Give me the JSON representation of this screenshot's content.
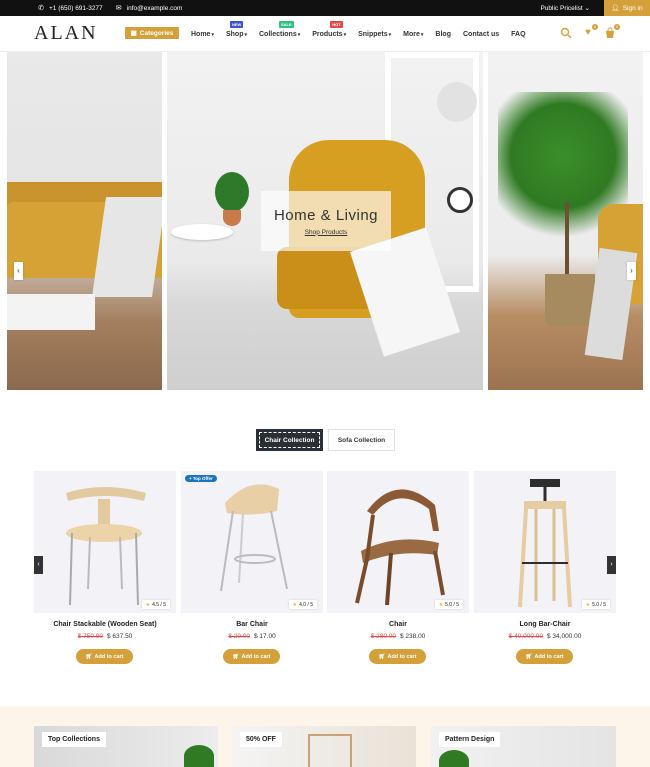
{
  "topbar": {
    "phone": "+1 (650) 691-3277",
    "email": "info@example.com",
    "pricelist": "Public Pricelist",
    "signin": "Sign in"
  },
  "header": {
    "logo": "ALAN",
    "categories": "Categories",
    "nav": [
      {
        "label": "Home",
        "chevron": true
      },
      {
        "label": "Shop",
        "chevron": true,
        "badge": "NEW",
        "badge_color": "#3f51d6"
      },
      {
        "label": "Collections",
        "chevron": true,
        "badge": "SALE",
        "badge_color": "#2ec27e"
      },
      {
        "label": "Products",
        "chevron": true,
        "badge": "HOT",
        "badge_color": "#e34b4b"
      },
      {
        "label": "Snippets",
        "chevron": true
      },
      {
        "label": "More",
        "chevron": true
      },
      {
        "label": "Blog",
        "chevron": false
      },
      {
        "label": "Contact us",
        "chevron": false
      },
      {
        "label": "FAQ",
        "chevron": false
      }
    ],
    "wishlist_count": "0",
    "cart_count": "0"
  },
  "hero": {
    "title": "Home & Living",
    "link": "Shop Products"
  },
  "tabs": {
    "active": "Chair Collection",
    "inactive": "Sofa Collection"
  },
  "products": [
    {
      "name": "Chair Stackable (Wooden Seat)",
      "old_price": "$ 750.00",
      "price": "$ 637.50",
      "rating": "4.5 / 5",
      "tag": "",
      "cart": "Add to cart"
    },
    {
      "name": "Bar Chair",
      "old_price": "$ 20.00",
      "price": "$ 17.00",
      "rating": "4.0 / 5",
      "tag": "Top Offer",
      "cart": "Add to cart"
    },
    {
      "name": "Chair",
      "old_price": "$ 280.00",
      "price": "$ 238.00",
      "rating": "5.0 / 5",
      "tag": "",
      "cart": "Add to cart"
    },
    {
      "name": "Long Bar-Chair",
      "old_price": "$ 40,000.00",
      "price": "$ 34,000.00",
      "rating": "5.0 / 5",
      "tag": "",
      "cart": "Add to cart"
    }
  ],
  "banners": [
    {
      "label": "Top Collections"
    },
    {
      "label": "50% OFF"
    },
    {
      "label": "Pattern Design"
    }
  ],
  "colors": {
    "accent": "#d4a03a",
    "dark": "#111111"
  }
}
